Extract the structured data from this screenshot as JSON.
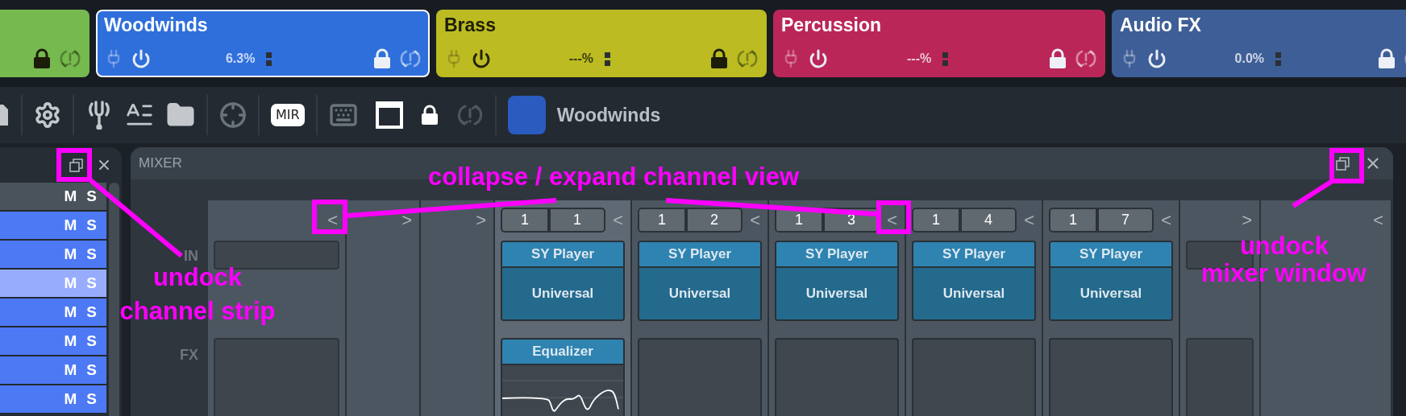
{
  "track_cards": [
    {
      "color": "#76b94f",
      "dark_text": true,
      "selected": false
    },
    {
      "title": "Woodwinds",
      "reading": "6.3%",
      "color": "#2f6fdb",
      "dark_text": false,
      "selected": true
    },
    {
      "title": "Brass",
      "reading": "---%",
      "color": "#bcbb22",
      "dark_text": true,
      "selected": false
    },
    {
      "title": "Percussion",
      "reading": "---%",
      "color": "#bb2659",
      "dark_text": false,
      "selected": false
    },
    {
      "title": "Audio FX",
      "reading": "0.0%",
      "color": "#3e5e97",
      "dark_text": false,
      "selected": false
    }
  ],
  "toolbar": {
    "badge": "MIR",
    "instrument": {
      "name": "Woodwinds",
      "color": "#2a5bbf"
    }
  },
  "track_list": {
    "rows": [
      {
        "mute": "M",
        "solo": "S",
        "color": "#4a525b"
      },
      {
        "mute": "M",
        "solo": "S",
        "color": "#4d79f4"
      },
      {
        "mute": "M",
        "solo": "S",
        "color": "#4d79f4"
      },
      {
        "mute": "M",
        "solo": "S",
        "color": "#98acfd"
      },
      {
        "mute": "M",
        "solo": "S",
        "color": "#4d79f4"
      },
      {
        "mute": "M",
        "solo": "S",
        "color": "#4d79f4"
      },
      {
        "mute": "M",
        "solo": "S",
        "color": "#4d79f4"
      },
      {
        "mute": "M",
        "solo": "S",
        "color": "#4d79f4"
      }
    ]
  },
  "mixer": {
    "title": "MIXER",
    "row_labels": [
      "IN",
      "FX"
    ],
    "strips": [
      {
        "kind": "input",
        "arrow": "<"
      },
      {
        "kind": "collapsed",
        "arrow": ">"
      },
      {
        "kind": "collapsed",
        "arrow": ">"
      },
      {
        "kind": "channel",
        "arrow": "<",
        "channel": [
          "1",
          "1"
        ],
        "instrument": "SY Player",
        "preset": "Universal",
        "fx": [
          "Equalizer"
        ],
        "selected": true
      },
      {
        "kind": "channel",
        "arrow": "<",
        "channel": [
          "1",
          "2"
        ],
        "instrument": "SY Player",
        "preset": "Universal",
        "selected": false
      },
      {
        "kind": "channel",
        "arrow": "<",
        "channel": [
          "1",
          "3"
        ],
        "instrument": "SY Player",
        "preset": "Universal",
        "selected": false
      },
      {
        "kind": "channel",
        "arrow": "<",
        "channel": [
          "1",
          "4"
        ],
        "instrument": "SY Player",
        "preset": "Universal",
        "selected": false
      },
      {
        "kind": "channel",
        "arrow": "<",
        "channel": [
          "1",
          "7"
        ],
        "instrument": "SY Player",
        "preset": "Universal",
        "selected": false
      },
      {
        "kind": "compact",
        "arrow": ">"
      },
      {
        "kind": "empty",
        "arrow": "<"
      }
    ]
  },
  "annotations": [
    {
      "text": "undock"
    },
    {
      "text": "channel strip"
    },
    {
      "text": "collapse / expand channel view"
    },
    {
      "text": "undock"
    },
    {
      "text": "mixer window"
    }
  ]
}
